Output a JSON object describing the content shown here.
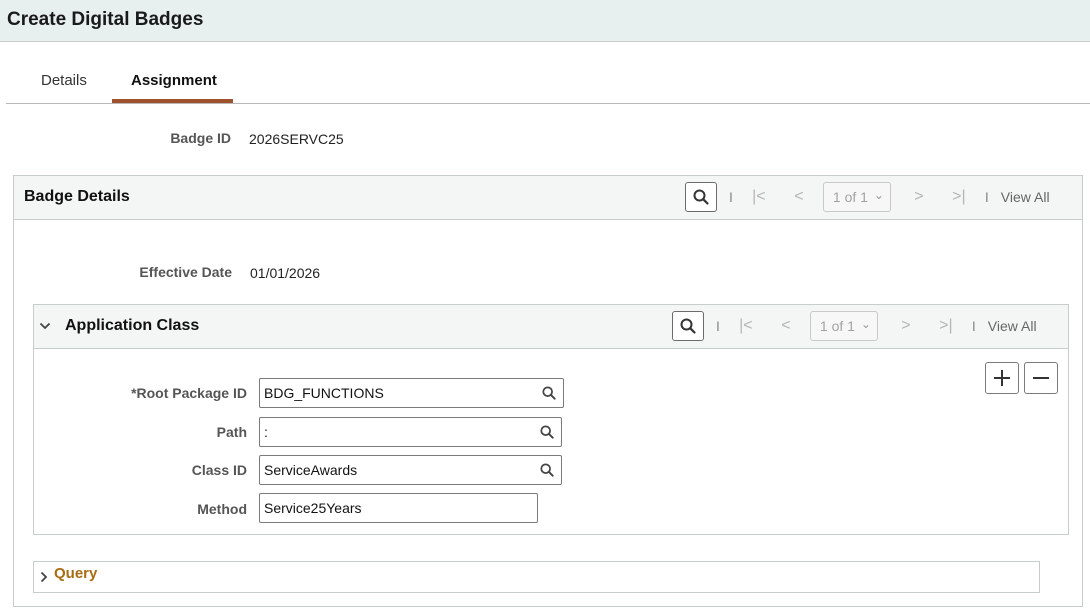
{
  "page": {
    "title": "Create Digital Badges"
  },
  "tabs": [
    {
      "label": "Details",
      "active": false
    },
    {
      "label": "Assignment",
      "active": true
    }
  ],
  "badge": {
    "id_label": "Badge ID",
    "id_value": "2026SERVC25"
  },
  "badge_details": {
    "title": "Badge Details",
    "pager": "1 of 1",
    "view_all": "View All",
    "effective_date_label": "Effective Date",
    "effective_date_value": "01/01/2026"
  },
  "app_class": {
    "title": "Application Class",
    "pager": "1 of 1",
    "view_all": "View All",
    "fields": {
      "root_package_label": "*Root Package ID",
      "root_package_value": "BDG_FUNCTIONS",
      "path_label": "Path",
      "path_value": ":",
      "class_id_label": "Class ID",
      "class_id_value": "ServiceAwards",
      "method_label": "Method",
      "method_value": "Service25Years"
    }
  },
  "query": {
    "title": "Query"
  },
  "nav_glyphs": {
    "sep": "I",
    "first": "|<",
    "prev": "<",
    "next": ">",
    "last": ">|",
    "caret": "⌄"
  },
  "colors": {
    "active_tab_underline": "#a0522d",
    "query_link": "#a86d12",
    "header_bg": "#e8efef"
  }
}
